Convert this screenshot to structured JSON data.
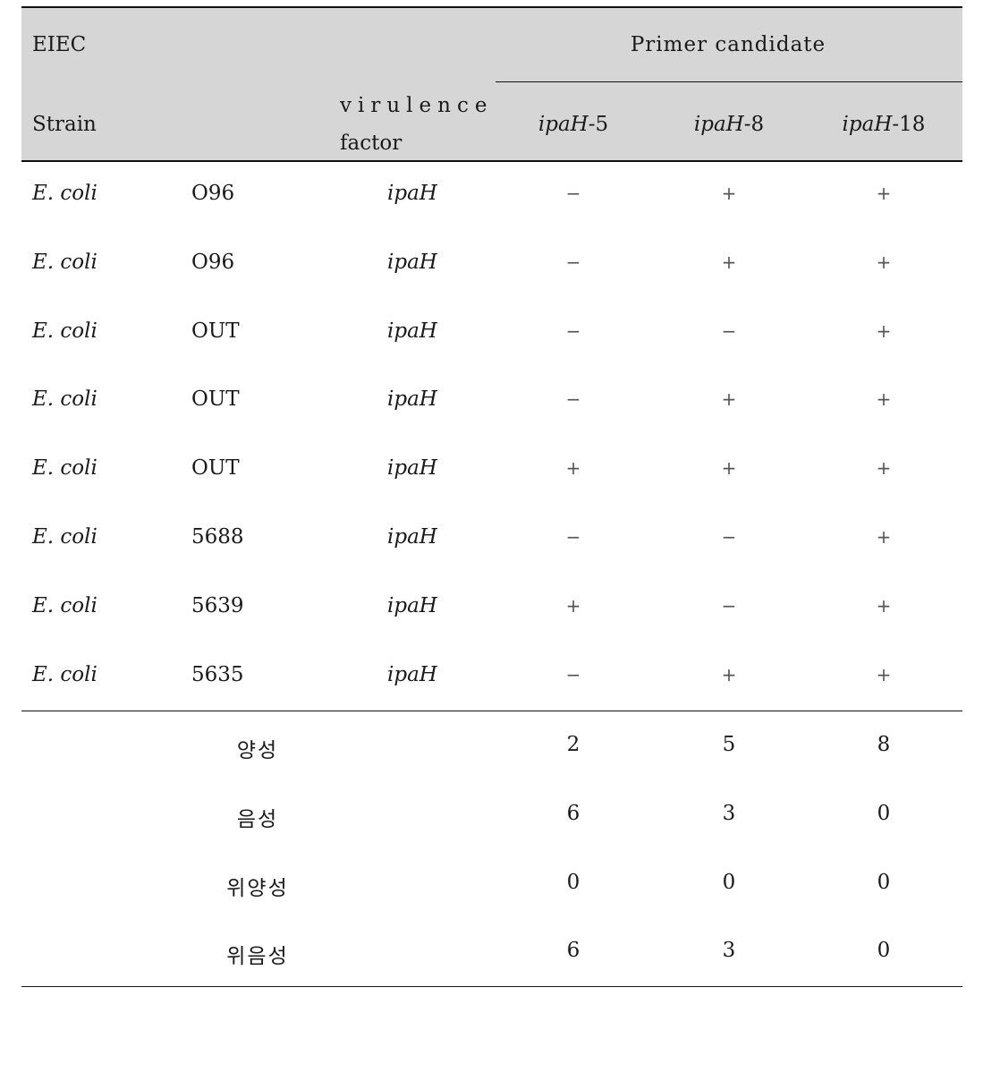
{
  "header": {
    "col_group_label": "EIEC",
    "primer_candidate_label": "Primer candidate",
    "strain_label": "Strain",
    "virulence_label_line1": "virulence",
    "virulence_label_line2": "factor",
    "primers": [
      {
        "gene": "ipaH",
        "suffix": "-5"
      },
      {
        "gene": "ipaH",
        "suffix": "-8"
      },
      {
        "gene": "ipaH",
        "suffix": "-18"
      }
    ]
  },
  "rows": [
    {
      "species": "E. coli",
      "strain": "O96",
      "factor": "ipaH",
      "results": [
        "−",
        "+",
        "+"
      ]
    },
    {
      "species": "E. coli",
      "strain": "O96",
      "factor": "ipaH",
      "results": [
        "−",
        "+",
        "+"
      ]
    },
    {
      "species": "E. coli",
      "strain": "OUT",
      "factor": "ipaH",
      "results": [
        "−",
        "−",
        "+"
      ]
    },
    {
      "species": "E. coli",
      "strain": "OUT",
      "factor": "ipaH",
      "results": [
        "−",
        "+",
        "+"
      ]
    },
    {
      "species": "E. coli",
      "strain": "OUT",
      "factor": "ipaH",
      "results": [
        "+",
        "+",
        "+"
      ]
    },
    {
      "species": "E. coli",
      "strain": "5688",
      "factor": "ipaH",
      "results": [
        "−",
        "−",
        "+"
      ]
    },
    {
      "species": "E. coli",
      "strain": "5639",
      "factor": "ipaH",
      "results": [
        "+",
        "−",
        "+"
      ]
    },
    {
      "species": "E. coli",
      "strain": "5635",
      "factor": "ipaH",
      "results": [
        "−",
        "+",
        "+"
      ]
    }
  ],
  "summary": [
    {
      "label": "양성",
      "values": [
        "2",
        "5",
        "8"
      ]
    },
    {
      "label": "음성",
      "values": [
        "6",
        "3",
        "0"
      ]
    },
    {
      "label": "위양성",
      "values": [
        "0",
        "0",
        "0"
      ]
    },
    {
      "label": "위음성",
      "values": [
        "6",
        "3",
        "0"
      ]
    }
  ],
  "colors": {
    "header_bg": "#d6d6d6",
    "rule": "#111111",
    "sign": "#555555"
  }
}
